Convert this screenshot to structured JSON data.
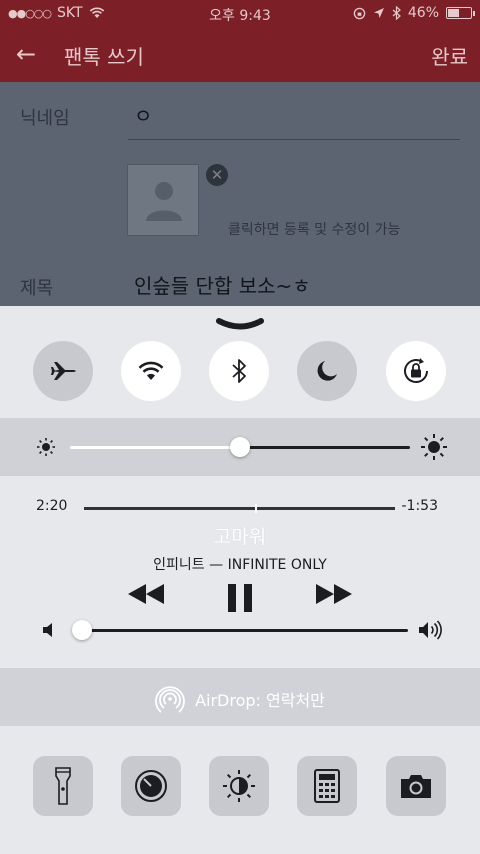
{
  "status_bar": {
    "signal_dots": "●●○○○",
    "carrier": "SKT",
    "time": "오후 9:43",
    "battery_text": "46%",
    "battery_level": 0.46
  },
  "app_bar": {
    "title": "팬톡 쓰기",
    "done_label": "완료",
    "back_glyph": "←"
  },
  "form": {
    "nickname_label": "닉네임",
    "nickname_value": "ㅇ",
    "photo_remove_glyph": "✕",
    "photo_hint": "클릭하면 등록 및 수정이 가능",
    "subject_label": "제목",
    "subject_value": "인슾들 단합 보소~ㅎ"
  },
  "control_center": {
    "toggles": [
      {
        "name": "airplane-mode",
        "icon": "airplane-icon",
        "on": false
      },
      {
        "name": "wifi",
        "icon": "wifi-icon",
        "on": true
      },
      {
        "name": "bluetooth",
        "icon": "bluetooth-icon",
        "on": true
      },
      {
        "name": "do-not-disturb",
        "icon": "moon-icon",
        "on": false
      },
      {
        "name": "rotation-lock",
        "icon": "rotation-lock-icon",
        "on": true
      }
    ],
    "brightness_level": 0.5,
    "music": {
      "elapsed": "2:20",
      "remaining": "-1:53",
      "progress": 0.55,
      "song_title": "고마워",
      "artist_album": "인피니트 — INFINITE ONLY",
      "volume_level": 0.0
    },
    "airdrop_label": "AirDrop: 연락처만",
    "quick_actions": [
      {
        "name": "flashlight",
        "icon": "flashlight-icon"
      },
      {
        "name": "timer",
        "icon": "timer-icon"
      },
      {
        "name": "night-shift",
        "icon": "night-shift-icon"
      },
      {
        "name": "calculator",
        "icon": "calculator-icon"
      },
      {
        "name": "camera",
        "icon": "camera-icon"
      }
    ]
  },
  "colors": {
    "app_bar_red": "#7d1f26",
    "control_center_bg": "#e7e8ec",
    "toggle_on": "#ffffff",
    "toggle_off": "#c7c9cf"
  }
}
